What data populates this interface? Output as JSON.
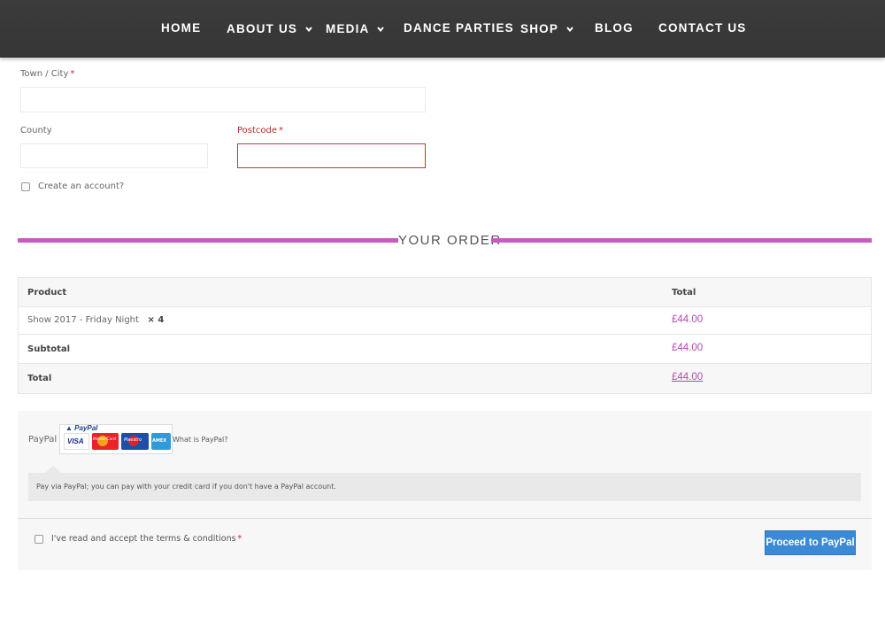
{
  "nav": {
    "items": [
      {
        "label": "HOME",
        "has_dropdown": false
      },
      {
        "label": "ABOUT US",
        "has_dropdown": true
      },
      {
        "label": "MEDIA",
        "has_dropdown": true
      },
      {
        "label": "DANCE PARTIES",
        "has_dropdown": false
      },
      {
        "label": "SHOP",
        "has_dropdown": true
      },
      {
        "label": "BLOG",
        "has_dropdown": false
      },
      {
        "label": "CONTACT US",
        "has_dropdown": false
      }
    ],
    "dropdown_icon": "chevron-down-icon"
  },
  "form": {
    "town_label": "Town / City",
    "town_value": "",
    "county_label": "County",
    "county_value": "",
    "postcode_label": "Postcode",
    "postcode_value": "",
    "required_mark": "*",
    "create_account_label": "Create an account?",
    "create_account_checked": false
  },
  "order": {
    "heading": "YOUR ORDER",
    "col_product": "Product",
    "col_total": "Total",
    "item": {
      "name": "Show 2017 - Friday Night",
      "qty": "× 4",
      "total": "£44.00"
    },
    "subtotal_label": "Subtotal",
    "subtotal_value": "£44.00",
    "total_label": "Total",
    "total_value": "£44.00"
  },
  "payment": {
    "method_label": "PayPal",
    "paypal_logo_text": "PayPal",
    "cards": [
      "VISA",
      "MasterCard",
      "Maestro",
      "AMEX"
    ],
    "what_is_link": "What is PayPal?",
    "description": "Pay via PayPal; you can pay with your credit card if you don't have a PayPal account.",
    "terms_label": "I've read and accept the terms & conditions",
    "terms_checked": false,
    "submit_label": "Proceed to PayPal"
  },
  "colors": {
    "accent": "#c85ac1",
    "price": "#b24ab0",
    "button": "#3a8ad6",
    "error": "#cc3333",
    "nav_bg": "#383838"
  }
}
